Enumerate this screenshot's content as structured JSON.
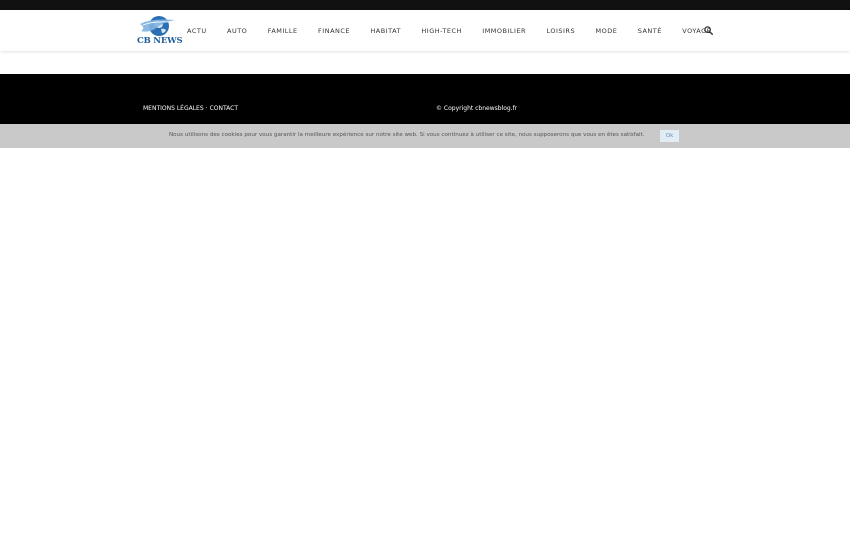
{
  "header": {
    "logo": {
      "text": "CB NEWS",
      "icon": "globe-ribbon-logo"
    },
    "nav": [
      {
        "label": "ACTU"
      },
      {
        "label": "AUTO"
      },
      {
        "label": "FAMILLE"
      },
      {
        "label": "FINANCE"
      },
      {
        "label": "HABITAT"
      },
      {
        "label": "HIGH-TECH"
      },
      {
        "label": "IMMOBILIER"
      },
      {
        "label": "LOISIRS"
      },
      {
        "label": "MODE"
      },
      {
        "label": "SANTÉ"
      },
      {
        "label": "VOYAGE"
      }
    ],
    "search_icon": "search-icon"
  },
  "footer": {
    "links": [
      {
        "label": "MENTIONS LÉGALES"
      },
      {
        "label": "CONTACT"
      }
    ],
    "separator": "·",
    "copyright": "© Copyright cbnewsblog.fr"
  },
  "cookie_bar": {
    "message": "Nous utilisons des cookies pour vous garantir la meilleure expérience sur notre site web. Si vous continuez à utiliser ce site, nous supposerons que vous en êtes satisfait.",
    "ok_label": "Ok"
  },
  "colors": {
    "topbar": "#111111",
    "footer": "#000000",
    "cookie_bar": "#c9c9c9",
    "logo_blue": "#1f5e9c",
    "ok_button": "#e2ecf5"
  }
}
